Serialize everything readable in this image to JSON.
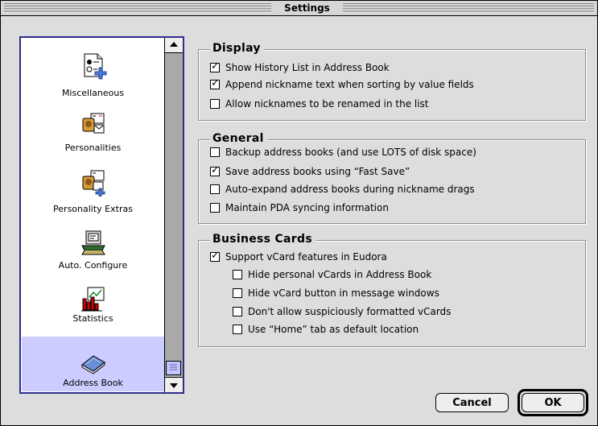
{
  "window": {
    "title": "Settings"
  },
  "sidebar": {
    "items": [
      {
        "label": "Miscellaneous",
        "icon": "miscellaneous-icon",
        "selected": false
      },
      {
        "label": "Personalities",
        "icon": "personalities-icon",
        "selected": false
      },
      {
        "label": "Personality Extras",
        "icon": "personality-extras-icon",
        "selected": false
      },
      {
        "label": "Auto. Configure",
        "icon": "auto-configure-icon",
        "selected": false
      },
      {
        "label": "Statistics",
        "icon": "statistics-icon",
        "selected": false
      },
      {
        "label": "Address Book",
        "icon": "address-book-icon",
        "selected": true
      }
    ]
  },
  "display": {
    "title": "Display",
    "options": [
      {
        "label": "Show History List in Address Book",
        "checked": true
      },
      {
        "label": "Append nickname text when sorting by value fields",
        "checked": true
      },
      {
        "label": "Allow nicknames to be renamed in the list",
        "checked": false
      }
    ]
  },
  "general": {
    "title": "General",
    "options": [
      {
        "label": "Backup address books (and use LOTS of disk space)",
        "checked": false
      },
      {
        "label": "Save address books using “Fast Save”",
        "checked": true
      },
      {
        "label": "Auto-expand address books during nickname drags",
        "checked": false
      },
      {
        "label": "Maintain PDA syncing information",
        "checked": false
      }
    ]
  },
  "business_cards": {
    "title": "Business Cards",
    "options": [
      {
        "label": "Support vCard features in Eudora",
        "checked": true
      },
      {
        "label": "Hide personal vCards in Address Book",
        "checked": false
      },
      {
        "label": "Hide vCard button in message windows",
        "checked": false
      },
      {
        "label": "Don't allow suspiciously formatted vCards",
        "checked": false
      },
      {
        "label": "Use “Home” tab as default location",
        "checked": false
      }
    ]
  },
  "buttons": {
    "cancel": "Cancel",
    "ok": "OK"
  },
  "check_mark": "✓"
}
